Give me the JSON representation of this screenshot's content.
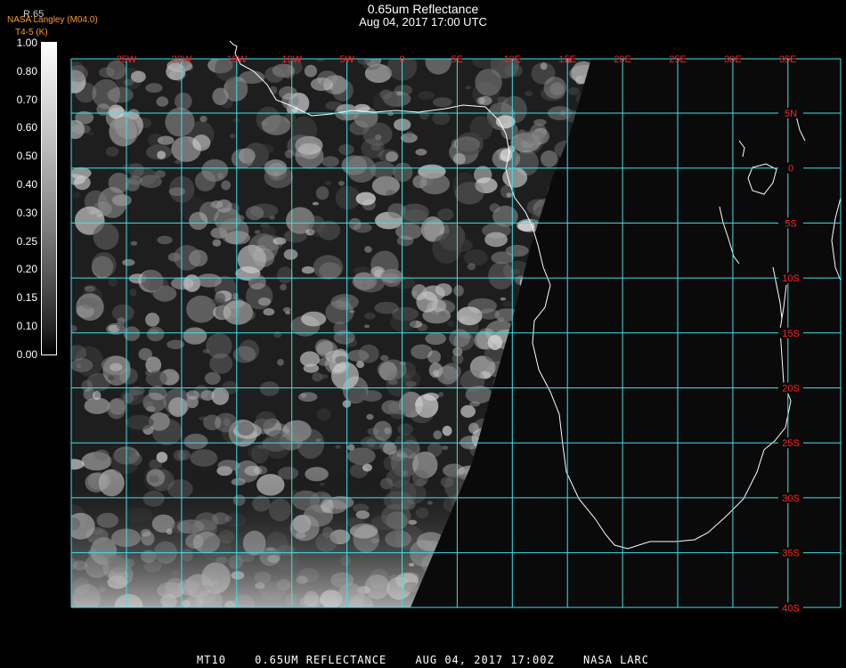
{
  "header": {
    "title": "0.65um Reflectance",
    "subtitle": "Aug 04, 2017 17:00 UTC",
    "credit_line1": "NASA Langley (M04.0)",
    "credit_line2": "T4-5 (K)",
    "scale_top_label": "R.65"
  },
  "colorbar": {
    "ticks": [
      "1.00",
      "0.80",
      "0.70",
      "0.60",
      "0.50",
      "0.40",
      "0.30",
      "0.25",
      "0.20",
      "0.15",
      "0.10",
      "0.00"
    ]
  },
  "map": {
    "lon_labels": [
      "25W",
      "20W",
      "15W",
      "10W",
      "5W",
      "0",
      "5E",
      "10E",
      "15E",
      "20E",
      "25E",
      "30E",
      "35E"
    ],
    "lat_labels": [
      "5N",
      "0",
      "5S",
      "10S",
      "15S",
      "20S",
      "25S",
      "30S",
      "35S",
      "40S"
    ],
    "grid_color": "#40e0e8",
    "label_color": "#ff2020",
    "space_color": "#0a0a0a"
  },
  "footer": {
    "satellite": "MT10",
    "product": "0.65UM REFLECTANCE",
    "datetime": "AUG 04, 2017 17:00Z",
    "source": "NASA LARC"
  }
}
